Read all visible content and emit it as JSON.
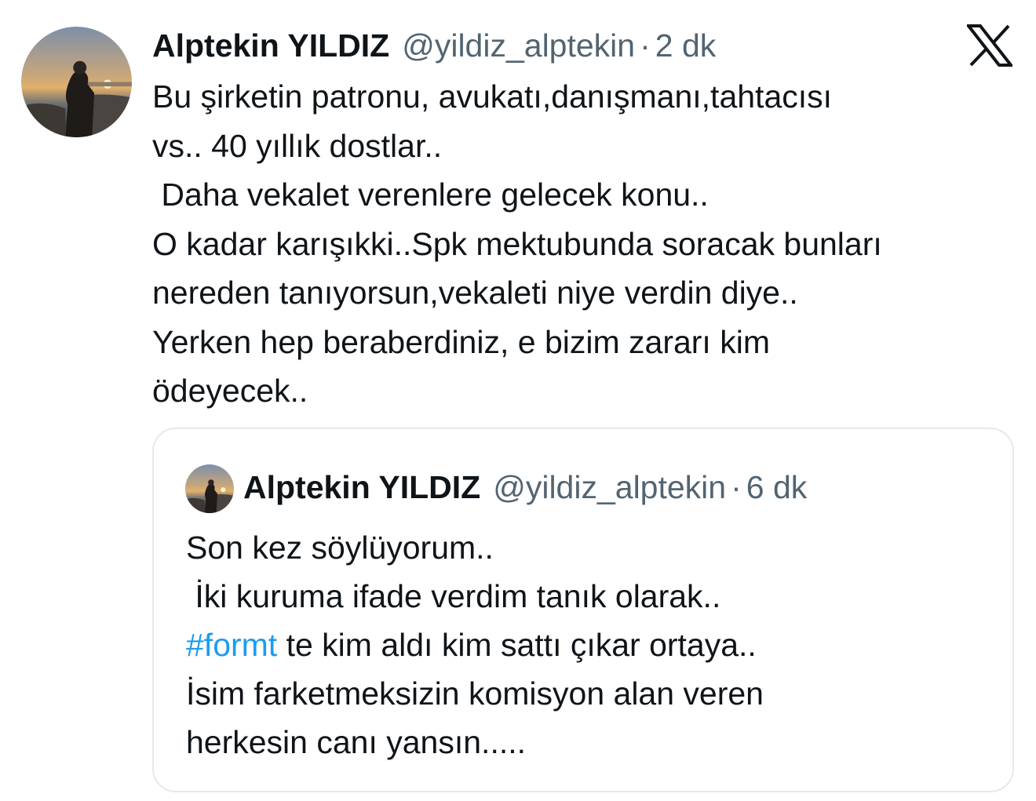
{
  "tweet": {
    "avatar_icon": "profile-photo-sunset",
    "author_name": "Alptekin YILDIZ",
    "author_handle": "@yildiz_alptekin",
    "separator": "·",
    "time": "2 dk",
    "platform_icon": "x-logo-icon",
    "body": "Bu şirketin patronu, avukatı,danışmanı,tahtacısı\nvs.. 40 yıllık dostlar..\n Daha vekalet verenlere gelecek konu..\nO kadar karışıkki..Spk mektubunda soracak bunları\nnereden tanıyorsun,vekaleti niye verdin diye..\nYerken hep beraberdiniz, e bizim zararı kim\nödeyecek.."
  },
  "quoted_tweet": {
    "avatar_icon": "profile-photo-sunset",
    "author_name": "Alptekin YILDIZ",
    "author_handle": "@yildiz_alptekin",
    "separator": "·",
    "time": "6 dk",
    "body_before": "Son kez söylüyorum..\n İki kuruma ifade verdim tanık olarak..\n",
    "hashtag": "#formt",
    "body_after": " te kim aldı kim sattı çıkar ortaya..\nİsim farketmeksizin komisyon alan veren\nherkesin canı yansın....."
  },
  "colors": {
    "text": "#0f1419",
    "secondary": "#536471",
    "hashtag": "#1d9bf0",
    "border": "#e6e9ec"
  }
}
